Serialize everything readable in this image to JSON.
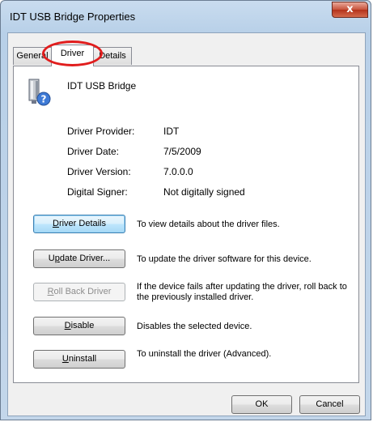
{
  "window": {
    "title": "IDT USB Bridge Properties",
    "close_glyph": "x"
  },
  "tabs": [
    {
      "label": "General",
      "active": false
    },
    {
      "label": "Driver",
      "active": true
    },
    {
      "label": "Details",
      "active": false
    }
  ],
  "device": {
    "name": "IDT USB Bridge",
    "icon": "usb-device-unknown-icon"
  },
  "info": {
    "provider_label": "Driver Provider:",
    "provider_value": "IDT",
    "date_label": "Driver Date:",
    "date_value": "7/5/2009",
    "version_label": "Driver Version:",
    "version_value": "7.0.0.0",
    "signer_label": "Digital Signer:",
    "signer_value": "Not digitally signed"
  },
  "actions": {
    "details": {
      "label_ul": "D",
      "label_rest": "river Details",
      "desc": "To view details about the driver files."
    },
    "update": {
      "label_pre": "U",
      "label_ul": "p",
      "label_rest": "date Driver...",
      "desc": "To update the driver software for this device."
    },
    "rollback": {
      "label_ul": "R",
      "label_rest": "oll Back Driver",
      "desc": "If the device fails after updating the driver, roll back to the previously installed driver.",
      "disabled": true
    },
    "disable": {
      "label_ul": "D",
      "label_rest": "isable",
      "desc": "Disables the selected device."
    },
    "uninstall": {
      "label_ul": "U",
      "label_rest": "ninstall",
      "desc": "To uninstall the driver (Advanced)."
    }
  },
  "footer": {
    "ok_label": "OK",
    "cancel_label": "Cancel"
  },
  "colors": {
    "highlight_circle": "#e11d1d",
    "close_button": "#c7513a"
  }
}
